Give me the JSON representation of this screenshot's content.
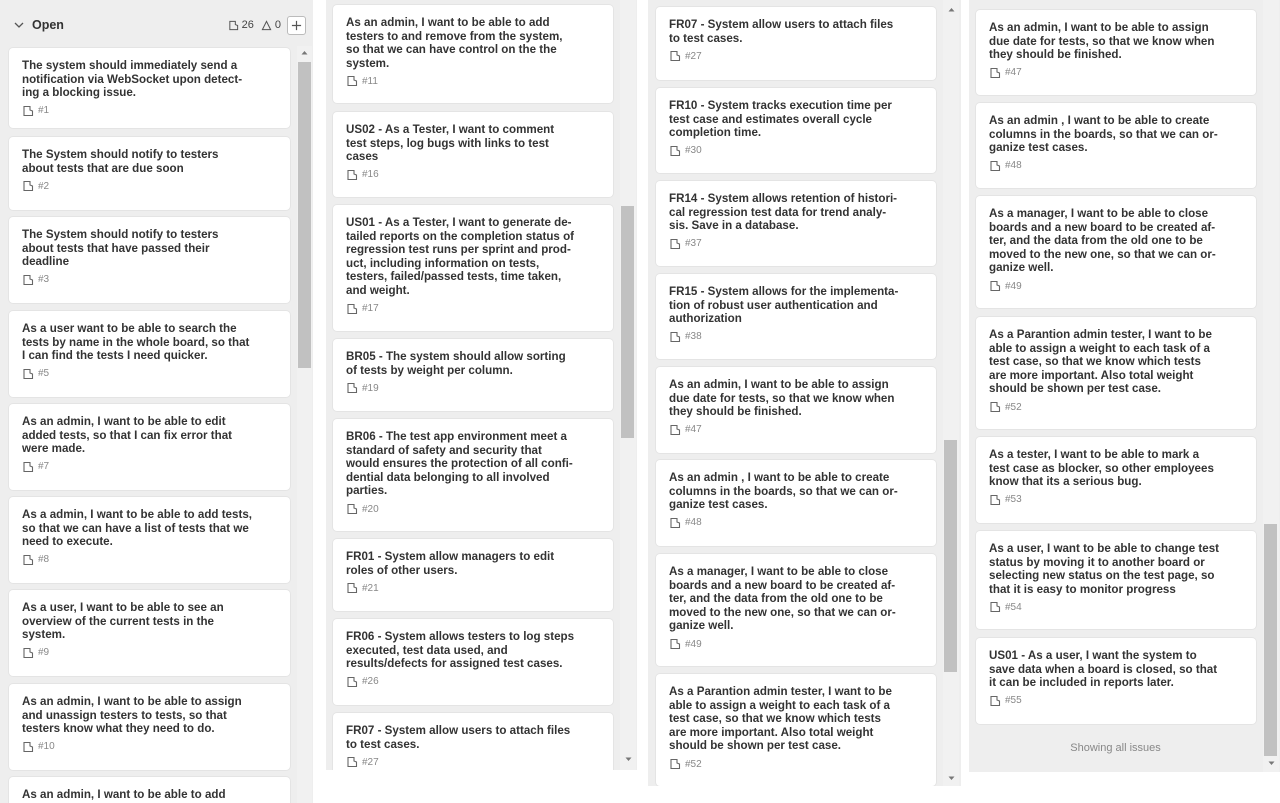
{
  "column": {
    "title": "Open",
    "issue_count": "26",
    "blocked_count": "0"
  },
  "col1": [
    {
      "title": "The system should immediately send a\nnotification via WebSocket upon detect-\ning a blocking issue.",
      "id": "#1"
    },
    {
      "title": "The System should notify to testers\nabout tests that are due soon",
      "id": "#2"
    },
    {
      "title": "The System should notify to testers\nabout tests that have passed their\ndeadline",
      "id": "#3"
    },
    {
      "title": "As a user want to be able to search the\ntests by name in the whole board, so that\nI can find the tests I need quicker.",
      "id": "#5"
    },
    {
      "title": "As an admin, I want to be able to edit\nadded tests, so that I can fix error that\nwere made.",
      "id": "#7"
    },
    {
      "title": "As a admin, I want to be able to add tests,\nso that we can have a list of tests that we\nneed to execute.",
      "id": "#8"
    },
    {
      "title": "As a user, I want to be able to see an\noverview of the current tests in the\nsystem.",
      "id": "#9"
    },
    {
      "title": "As an admin, I want to be able to assign\nand unassign testers to tests, so that\ntesters know what they need to do.",
      "id": "#10"
    },
    {
      "title": "As an admin, I want to be able to add",
      "id": ""
    }
  ],
  "col2": [
    {
      "title": "As an admin, I want to be able to add\ntesters to and remove from the system,\nso that we can have control on the the\nsystem.",
      "id": "#11"
    },
    {
      "title": "US02 - As a Tester, I want to comment\ntest steps, log bugs with links to test\ncases",
      "id": "#16"
    },
    {
      "title": "US01 - As a Tester, I want to generate de-\ntailed reports on the completion status of\nregression test runs per sprint and prod-\nuct, including information on tests,\ntesters, failed/passed tests, time taken,\nand weight.",
      "id": "#17"
    },
    {
      "title": "BR05 - The system should allow sorting\nof tests by weight per column.",
      "id": "#19"
    },
    {
      "title": "BR06 - The test app environment meet a\nstandard of safety and security that\nwould ensures the protection of all confi-\ndential data belonging to all involved\nparties.",
      "id": "#20"
    },
    {
      "title": "FR01 - System allow managers to edit\nroles of other users.",
      "id": "#21"
    },
    {
      "title": "FR06 - System allows testers to log steps\nexecuted, test data used, and\nresults/defects for assigned test cases.",
      "id": "#26"
    },
    {
      "title": "FR07 - System allow users to attach files\nto test cases.",
      "id": "#27"
    }
  ],
  "col3": [
    {
      "title": "FR07 - System allow users to attach files\nto test cases.",
      "id": "#27"
    },
    {
      "title": "FR10 - System tracks execution time per\ntest case and estimates overall cycle\ncompletion time.",
      "id": "#30"
    },
    {
      "title": "FR14 - System allows retention of histori-\ncal regression test data for trend analy-\nsis. Save in a database.",
      "id": "#37"
    },
    {
      "title": "FR15 - System allows for the implementa-\ntion of robust user authentication and\nauthorization",
      "id": "#38"
    },
    {
      "title": "As an admin, I want to be able to assign\ndue date for tests, so that we know when\nthey should be finished.",
      "id": "#47"
    },
    {
      "title": "As an admin , I want to be able to create\ncolumns in the boards, so that we can or-\nganize test cases.",
      "id": "#48"
    },
    {
      "title": "As a manager, I want to be able to close\nboards and a new board to be created af-\nter, and the data from the old one to be\nmoved to the new one, so that we can or-\nganize well.",
      "id": "#49"
    },
    {
      "title": "As a Parantion admin tester, I want to be\nable to assign a weight to each task of a\ntest case, so that we know which tests\nare more important. Also total weight\nshould be shown per test case.",
      "id": "#52"
    }
  ],
  "col4": [
    {
      "title": "As an admin, I want to be able to assign\ndue date for tests, so that we know when\nthey should be finished.",
      "id": "#47"
    },
    {
      "title": "As an admin , I want to be able to create\ncolumns in the boards, so that we can or-\nganize test cases.",
      "id": "#48"
    },
    {
      "title": "As a manager, I want to be able to close\nboards and a new board to be created af-\nter, and the data from the old one to be\nmoved to the new one, so that we can or-\nganize well.",
      "id": "#49"
    },
    {
      "title": "As a Parantion admin tester, I want to be\nable to assign a weight to each task of a\ntest case, so that we know which tests\nare more important. Also total weight\nshould be shown per test case.",
      "id": "#52"
    },
    {
      "title": "As a tester, I want to be able to mark a\ntest case as blocker, so other employees\nknow that its a serious bug.",
      "id": "#53"
    },
    {
      "title": "As a user, I want to be able to change test\nstatus by moving it to another board or\nselecting new status on the test page, so\nthat it is easy to monitor progress",
      "id": "#54"
    },
    {
      "title": "US01 - As a user, I want the system to\nsave data when a board is closed, so that\nit can be included in reports later.",
      "id": "#55"
    }
  ],
  "footer": {
    "showing_all": "Showing all issues"
  }
}
